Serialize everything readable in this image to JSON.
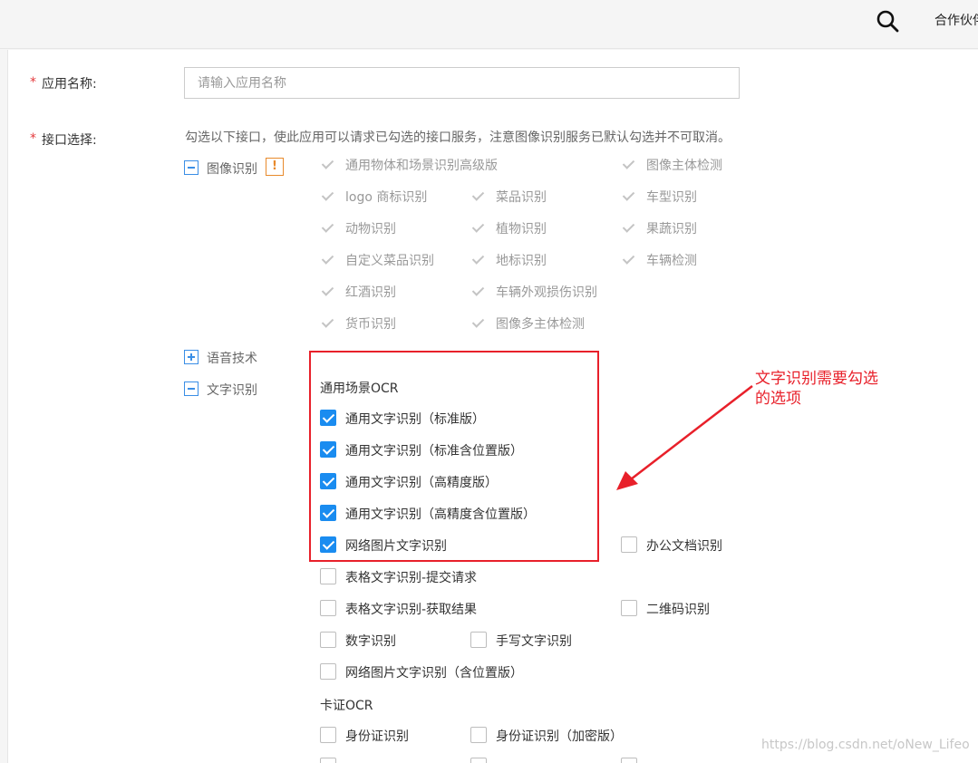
{
  "topbar": {
    "partner_label": "合作伙伴"
  },
  "form": {
    "required_mark": "*",
    "name_label": "应用名称:",
    "name_placeholder": "请输入应用名称",
    "api_label": "接口选择:",
    "hint": "勾选以下接口，使此应用可以请求已勾选的接口服务，注意图像识别服务已默认勾选并不可取消。"
  },
  "categories": {
    "image": {
      "label": "图像识别",
      "warn": "!"
    },
    "speech": {
      "label": "语音技术"
    },
    "ocr": {
      "label": "文字识别"
    }
  },
  "image_options": [
    {
      "label": "通用物体和场景识别高级版",
      "checked": true,
      "disabled": true
    },
    {
      "label": "图像主体检测",
      "checked": true,
      "disabled": true
    },
    {
      "label": "logo 商标识别",
      "checked": true,
      "disabled": true
    },
    {
      "label": "菜品识别",
      "checked": true,
      "disabled": true
    },
    {
      "label": "车型识别",
      "checked": true,
      "disabled": true
    },
    {
      "label": "动物识别",
      "checked": true,
      "disabled": true
    },
    {
      "label": "植物识别",
      "checked": true,
      "disabled": true
    },
    {
      "label": "果蔬识别",
      "checked": true,
      "disabled": true
    },
    {
      "label": "自定义菜品识别",
      "checked": true,
      "disabled": true
    },
    {
      "label": "地标识别",
      "checked": true,
      "disabled": true
    },
    {
      "label": "车辆检测",
      "checked": true,
      "disabled": true
    },
    {
      "label": "红酒识别",
      "checked": true,
      "disabled": true
    },
    {
      "label": "车辆外观损伤识别",
      "checked": true,
      "disabled": true
    },
    {
      "label": "货币识别",
      "checked": true,
      "disabled": true
    },
    {
      "label": "图像多主体检测",
      "checked": true,
      "disabled": true
    }
  ],
  "ocr_groups": [
    {
      "title": "通用场景OCR"
    },
    {
      "title": "卡证OCR"
    }
  ],
  "ocr_options": [
    {
      "label": "通用文字识别（标准版）",
      "checked": true
    },
    {
      "label": "通用文字识别（标准含位置版）",
      "checked": true
    },
    {
      "label": "通用文字识别（高精度版）",
      "checked": true
    },
    {
      "label": "通用文字识别（高精度含位置版）",
      "checked": true
    },
    {
      "label": "网络图片文字识别",
      "checked": true
    },
    {
      "label": "办公文档识别",
      "checked": false
    },
    {
      "label": "表格文字识别-提交请求",
      "checked": false
    },
    {
      "label": "表格文字识别-获取结果",
      "checked": false
    },
    {
      "label": "二维码识别",
      "checked": false
    },
    {
      "label": "数字识别",
      "checked": false
    },
    {
      "label": "手写文字识别",
      "checked": false
    },
    {
      "label": "网络图片文字识别（含位置版）",
      "checked": false
    },
    {
      "label": "身份证识别",
      "checked": false
    },
    {
      "label": "身份证识别（加密版）",
      "checked": false
    }
  ],
  "annotation": {
    "text": "文字识别需要勾选\n的选项",
    "color": "#e8202a"
  },
  "watermark": "https://blog.csdn.net/oNew_Lifeo",
  "colors": {
    "accent": "#1a8cf0",
    "required": "#e4393c",
    "highlight": "#e8202a",
    "warn": "#e88a2c"
  }
}
